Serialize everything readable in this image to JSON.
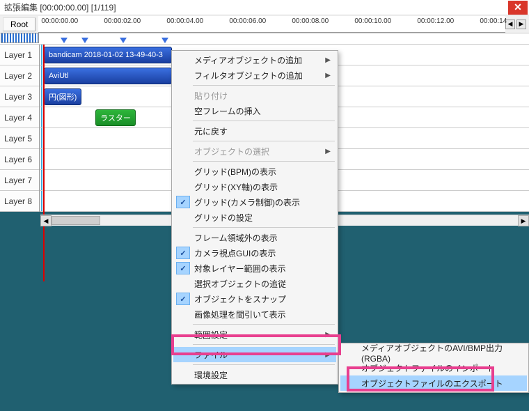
{
  "title": "拡張編集 [00:00:00.00] [1/119]",
  "root_button": "Root",
  "timeline_ticks": [
    "00:00:00.00",
    "00:00:02.00",
    "00:00:04.00",
    "00:00:06.00",
    "00:00:08.00",
    "00:00:10.00",
    "00:00:12.00",
    "00:00:14"
  ],
  "layers": [
    "Layer 1",
    "Layer 2",
    "Layer 3",
    "Layer 4",
    "Layer 5",
    "Layer 6",
    "Layer 7",
    "Layer 8"
  ],
  "clips": {
    "c1": "bandicam 2018-01-02 13-49-40-3",
    "c2": "AviUtl",
    "c3": "円(図形)",
    "c4": "ラスター"
  },
  "menu": {
    "add_media": "メディアオブジェクトの追加",
    "add_filter": "フィルタオブジェクトの追加",
    "paste": "貼り付け",
    "insert_empty": "空フレームの挿入",
    "undo": "元に戻す",
    "select_obj": "オブジェクトの選択",
    "grid_bpm": "グリッド(BPM)の表示",
    "grid_xy": "グリッド(XY軸)の表示",
    "grid_cam": "グリッド(カメラ制御)の表示",
    "grid_settings": "グリッドの設定",
    "frame_out": "フレーム領域外の表示",
    "camera_gui": "カメラ視点GUIの表示",
    "layer_range": "対象レイヤー範囲の表示",
    "follow_sel": "選択オブジェクトの追従",
    "snap": "オブジェクトをスナップ",
    "thin_image": "画像処理を間引いて表示",
    "range_set": "範囲設定",
    "file": "ファイル",
    "env": "環境設定"
  },
  "submenu": {
    "avi_bmp": "メディアオブジェクトのAVI/BMP出力(RGBA)",
    "import": "オブジェクトファイルのインポート",
    "export": "オブジェクトファイルのエクスポート"
  }
}
